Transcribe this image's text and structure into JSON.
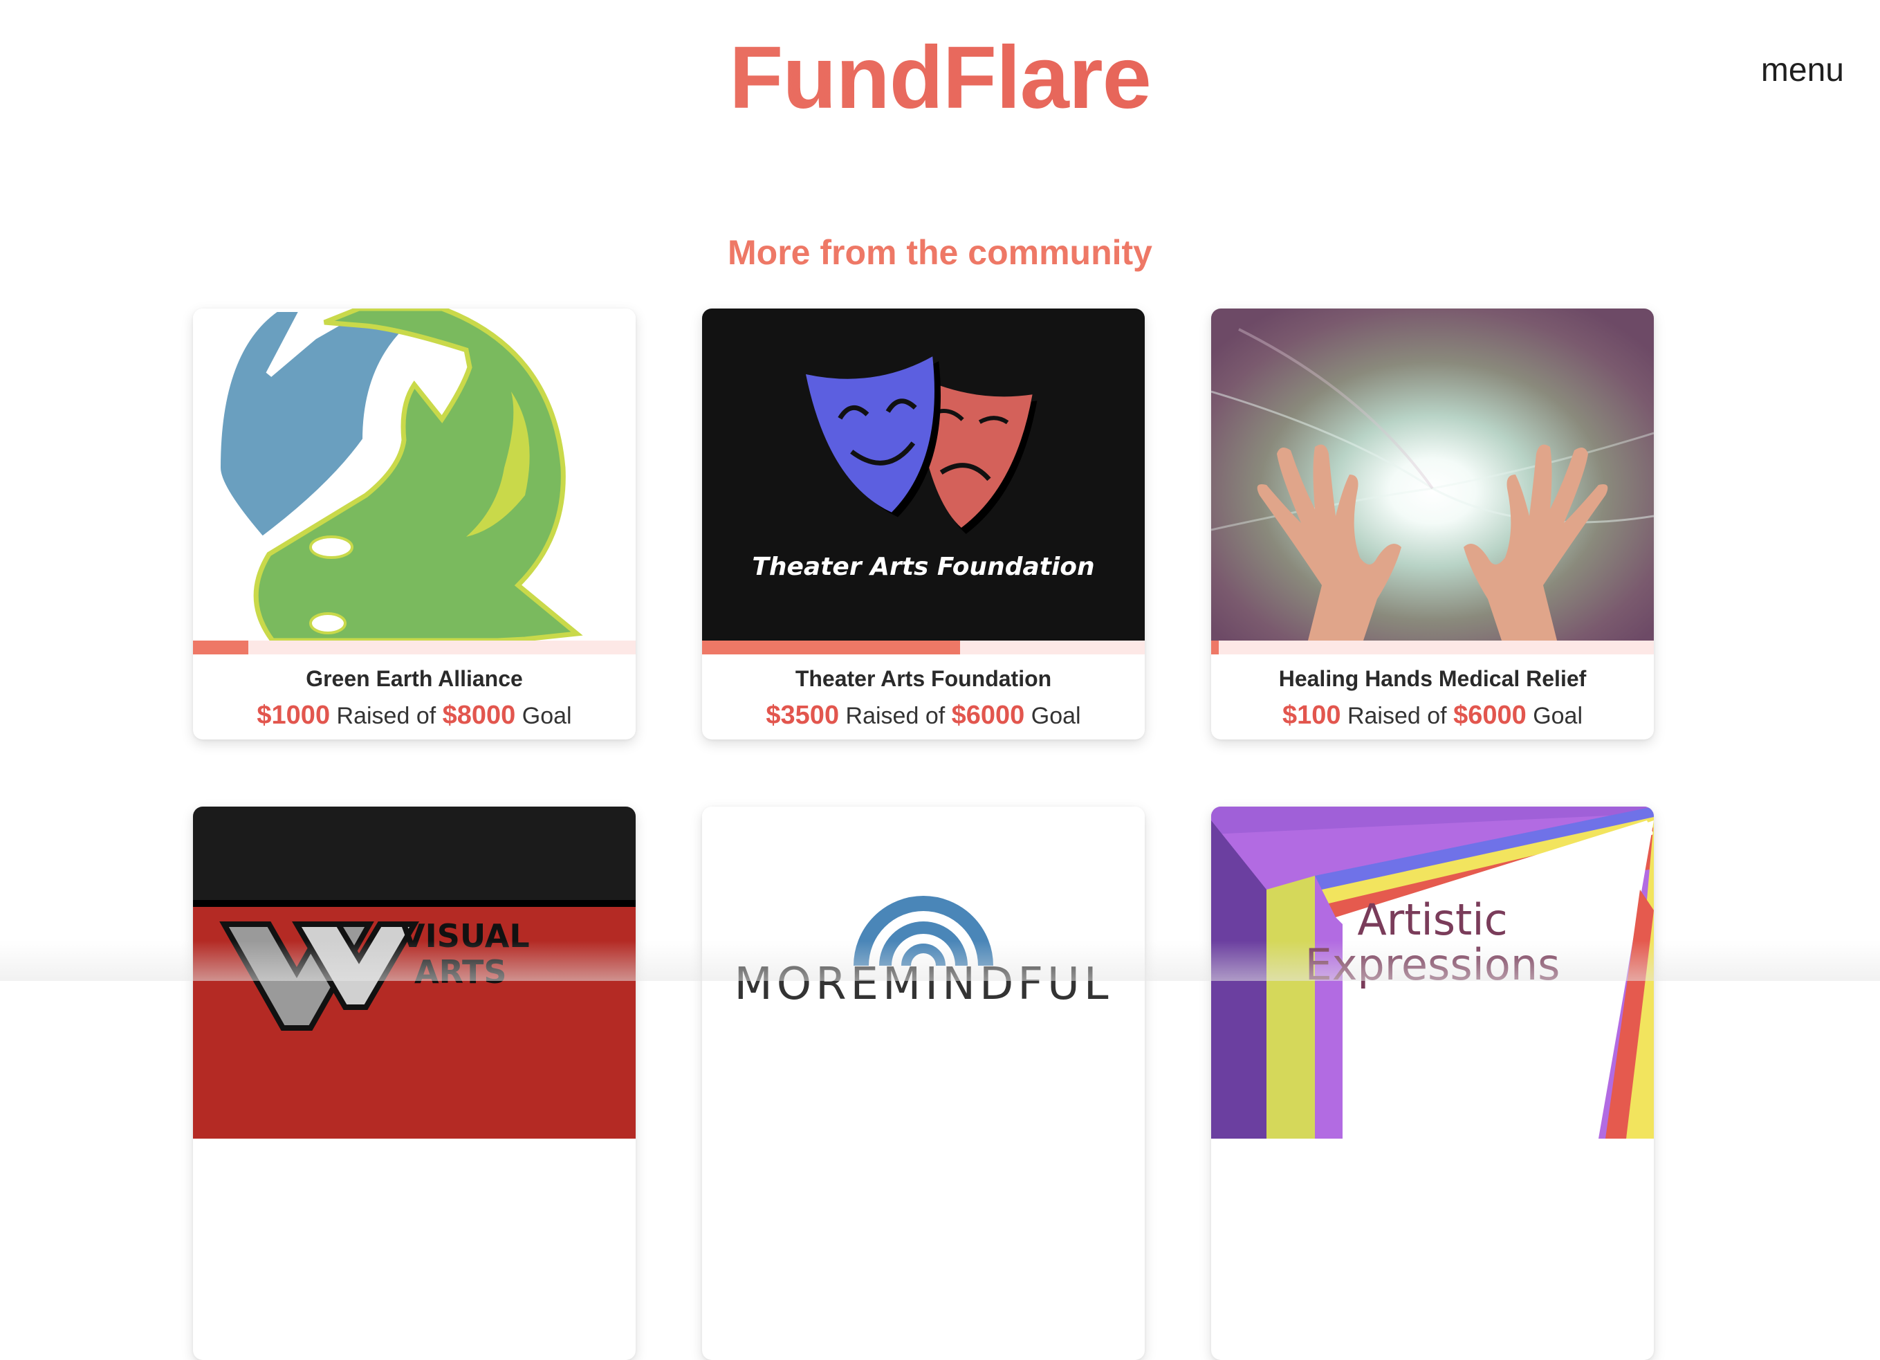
{
  "header": {
    "brand": "FundFlare",
    "menu_label": "menu"
  },
  "section": {
    "title": "More from the community"
  },
  "cards": [
    {
      "name": "Green Earth Alliance",
      "raised": "$1000",
      "raised_text": "Raised of",
      "goal": "$8000",
      "goal_text": "Goal",
      "progress": 0.125,
      "image": "green-earth-logo"
    },
    {
      "name": "Theater Arts Foundation",
      "raised": "$3500",
      "raised_text": "Raised of",
      "goal": "$6000",
      "goal_text": "Goal",
      "progress": 0.583,
      "image": "theater-masks-logo",
      "image_caption": "Theater Arts Foundation"
    },
    {
      "name": "Healing Hands Medical Relief",
      "raised": "$100",
      "raised_text": "Raised of",
      "goal": "$6000",
      "goal_text": "Goal",
      "progress": 0.017,
      "image": "healing-hands-photo"
    },
    {
      "image": "visual-arts-logo",
      "image_text_1": "VISUAL",
      "image_text_2": "ARTS"
    },
    {
      "image": "mindful-logo-partial",
      "image_text": "MOREMINDFUL"
    },
    {
      "image": "artistic-expressions-logo",
      "image_text_1": "Artistic",
      "image_text_2": "Expressions"
    }
  ],
  "colors": {
    "brand": "#e86a5a",
    "accent": "#ee7866",
    "progress_track": "#fde8e6"
  }
}
